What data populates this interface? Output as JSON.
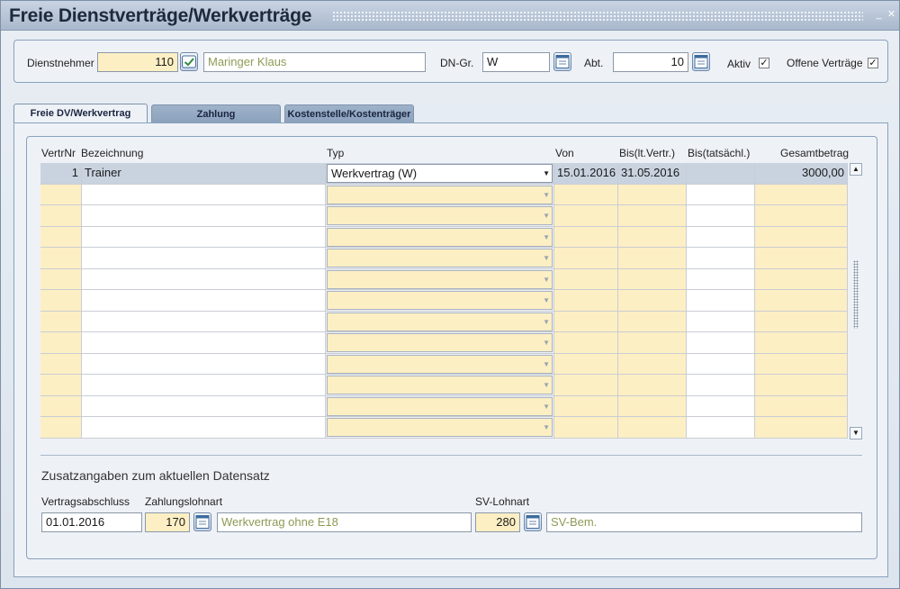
{
  "window": {
    "title": "Freie Dienstverträge/Werkverträge"
  },
  "header": {
    "dienstnehmer_label": "Dienstnehmer",
    "dienstnehmer_nr": "110",
    "dienstnehmer_name": "Maringer Klaus",
    "dngr_label": "DN-Gr.",
    "dngr_value": "W",
    "abt_label": "Abt.",
    "abt_value": "10",
    "aktiv_label": "Aktiv",
    "aktiv_checked": true,
    "offene_label": "Offene Verträge",
    "offene_checked": true
  },
  "tabs": [
    {
      "label": "Freie DV/Werkvertrag",
      "active": true
    },
    {
      "label": "Zahlung",
      "active": false
    },
    {
      "label": "Kostenstelle/Kostenträger",
      "active": false
    }
  ],
  "table": {
    "columns": [
      "VertrNr",
      "Bezeichnung",
      "Typ",
      "Von",
      "Bis(lt.Vertr.)",
      "Bis(tatsächl.)",
      "Gesamtbetrag"
    ],
    "rows": [
      {
        "nr": "1",
        "bez": "Trainer",
        "typ": "Werkvertrag (W)",
        "von": "15.01.2016",
        "bis": "31.05.2016",
        "bist": "",
        "ges": "3000,00"
      }
    ],
    "empty_rows": 12
  },
  "zusatz": {
    "title": "Zusatzangaben zum aktuellen Datensatz",
    "vertragsabschluss_label": "Vertragsabschluss",
    "vertragsabschluss_value": "01.01.2016",
    "zahlungslohnart_label": "Zahlungslohnart",
    "zahlungslohnart_nr": "170",
    "zahlungslohnart_text": "Werkvertrag ohne E18",
    "svlohnart_label": "SV-Lohnart",
    "svlohnart_nr": "280",
    "svlohnart_text": "SV-Bem."
  }
}
